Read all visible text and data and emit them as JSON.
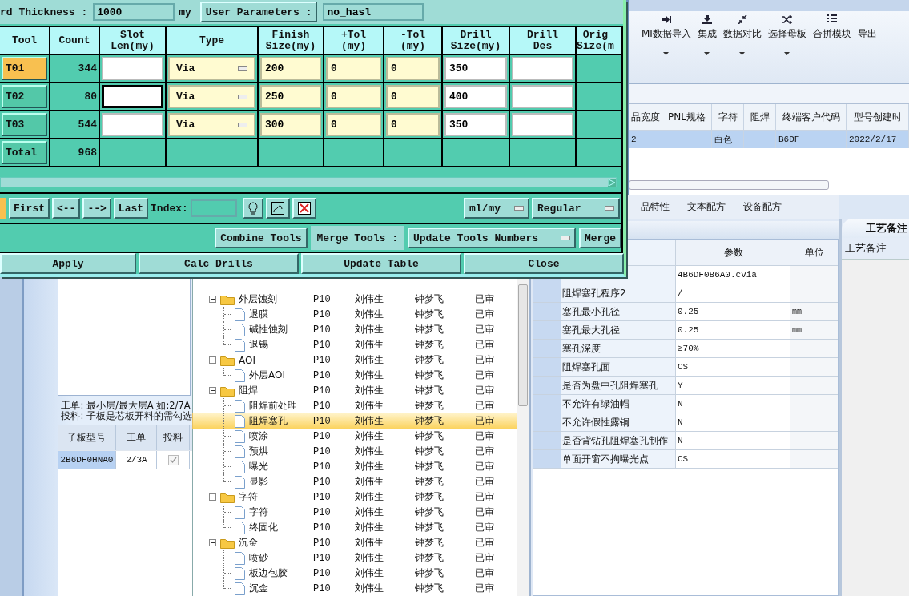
{
  "dialog": {
    "thickness_label": "rd Thickness :",
    "thickness_value": "1000",
    "thickness_unit": "my",
    "user_params_button": "User Parameters :",
    "user_params_value": "no_hasl",
    "columns": [
      "Tool",
      "Count",
      "Slot\nLen(my)",
      "Type",
      "Finish\nSize(my)",
      "+Tol\n(my)",
      "-Tol\n(my)",
      "Drill\nSize(my)",
      "Drill\nDes",
      "Orig\nSize(m"
    ],
    "tools": [
      {
        "tool": "T01",
        "count": "344",
        "selected": true,
        "slot_focused": false,
        "type": "Via",
        "finish": "200",
        "plus_tol": "0",
        "minus_tol": "0",
        "drill_size": "350"
      },
      {
        "tool": "T02",
        "count": "80",
        "selected": false,
        "slot_focused": true,
        "type": "Via",
        "finish": "250",
        "plus_tol": "0",
        "minus_tol": "0",
        "drill_size": "400"
      },
      {
        "tool": "T03",
        "count": "544",
        "selected": false,
        "slot_focused": false,
        "type": "Via",
        "finish": "300",
        "plus_tol": "0",
        "minus_tol": "0",
        "drill_size": "350"
      }
    ],
    "total": {
      "label": "Total",
      "count": "968"
    },
    "nav": [
      "First",
      "<--",
      "-->",
      "Last"
    ],
    "index_label": "Index:",
    "unit_select": "ml/my",
    "mode_select": "Regular",
    "combine_button": "Combine Tools",
    "merge_label": "Merge Tools :",
    "merge_select": "Update Tools Numbers",
    "merge_button": "Merge",
    "actions": [
      "Apply",
      "Calc Drills",
      "Update Table",
      "Close"
    ]
  },
  "toolbar": {
    "items": [
      {
        "label": "MI数据导入",
        "dropdown": true
      },
      {
        "label": "集成",
        "dropdown": true
      },
      {
        "label": "数据对比",
        "dropdown": true
      },
      {
        "label": "选择母板",
        "dropdown": true
      },
      {
        "label": "合拼模块",
        "dropdown": false
      },
      {
        "label": "导出",
        "dropdown": false
      }
    ]
  },
  "grid": {
    "columns": [
      "品宽度",
      "PNL规格",
      "字符",
      "阻焊",
      "终端客户代码",
      "型号创建时"
    ],
    "rows": [
      {
        "selected": true,
        "cells": [
          "2",
          "",
          "白色",
          "",
          "B6DF",
          "2022/2/17"
        ]
      }
    ]
  },
  "tabs": [
    {
      "label": "品特性",
      "selected": false
    },
    {
      "label": "文本配方",
      "selected": false
    },
    {
      "label": "设备配方",
      "selected": false
    }
  ],
  "left_panel": {
    "notes": [
      "工单: 最小层/最大层A 如:2/7A",
      "投料: 子板是芯板开料的需勾选"
    ],
    "columns": [
      "子板型号",
      "工单",
      "投料"
    ],
    "rows": [
      {
        "board": "2B6DF0HNA0",
        "order": "2/3A",
        "feed": true
      }
    ]
  },
  "tree": [
    {
      "name": "外层蚀刻",
      "expanded": true,
      "cols": [
        "P10",
        "刘伟生",
        "钟梦飞",
        "已审"
      ],
      "children": [
        {
          "name": "退膜",
          "selected": false,
          "cols": [
            "P10",
            "刘伟生",
            "钟梦飞",
            "已审"
          ]
        },
        {
          "name": "碱性蚀刻",
          "selected": false,
          "cols": [
            "P10",
            "刘伟生",
            "钟梦飞",
            "已审"
          ]
        },
        {
          "name": "退锡",
          "selected": false,
          "cols": [
            "P10",
            "刘伟生",
            "钟梦飞",
            "已审"
          ]
        }
      ]
    },
    {
      "name": "AOI",
      "expanded": true,
      "cols": [
        "P10",
        "刘伟生",
        "钟梦飞",
        "已审"
      ],
      "children": [
        {
          "name": "外层AOI",
          "selected": false,
          "cols": [
            "P10",
            "刘伟生",
            "钟梦飞",
            "已审"
          ]
        }
      ]
    },
    {
      "name": "阻焊",
      "expanded": true,
      "cols": [
        "P10",
        "刘伟生",
        "钟梦飞",
        "已审"
      ],
      "children": [
        {
          "name": "阻焊前处理",
          "selected": false,
          "cols": [
            "P10",
            "刘伟生",
            "钟梦飞",
            "已审"
          ]
        },
        {
          "name": "阻焊塞孔",
          "selected": true,
          "cols": [
            "P10",
            "刘伟生",
            "钟梦飞",
            "已审"
          ]
        },
        {
          "name": "喷涂",
          "selected": false,
          "cols": [
            "P10",
            "刘伟生",
            "钟梦飞",
            "已审"
          ]
        },
        {
          "name": "预烘",
          "selected": false,
          "cols": [
            "P10",
            "刘伟生",
            "钟梦飞",
            "已审"
          ]
        },
        {
          "name": "曝光",
          "selected": false,
          "cols": [
            "P10",
            "刘伟生",
            "钟梦飞",
            "已审"
          ]
        },
        {
          "name": "显影",
          "selected": false,
          "cols": [
            "P10",
            "刘伟生",
            "钟梦飞",
            "已审"
          ]
        }
      ]
    },
    {
      "name": "字符",
      "expanded": true,
      "cols": [
        "P10",
        "刘伟生",
        "钟梦飞",
        "已审"
      ],
      "children": [
        {
          "name": "字符",
          "selected": false,
          "cols": [
            "P10",
            "刘伟生",
            "钟梦飞",
            "已审"
          ]
        },
        {
          "name": "终固化",
          "selected": false,
          "cols": [
            "P10",
            "刘伟生",
            "钟梦飞",
            "已审"
          ]
        }
      ]
    },
    {
      "name": "沉金",
      "expanded": true,
      "cols": [
        "P10",
        "刘伟生",
        "钟梦飞",
        "已审"
      ],
      "children": [
        {
          "name": "喷砂",
          "selected": false,
          "cols": [
            "P10",
            "刘伟生",
            "钟梦飞",
            "已审"
          ]
        },
        {
          "name": "板边包胶",
          "selected": false,
          "cols": [
            "P10",
            "刘伟生",
            "钟梦飞",
            "已审"
          ]
        },
        {
          "name": "沉金",
          "selected": false,
          "cols": [
            "P10",
            "刘伟生",
            "钟梦飞",
            "已审"
          ]
        }
      ]
    }
  ],
  "params": {
    "columns": [
      "参数",
      "单位"
    ],
    "rows": [
      {
        "value": "4B6DF086A0.cvia"
      },
      {
        "name": "阻焊塞孔程序2",
        "value": "/"
      },
      {
        "name": "塞孔最小孔径",
        "value": "0.25",
        "unit": "mm"
      },
      {
        "name": "塞孔最大孔径",
        "value": "0.25",
        "unit": "mm"
      },
      {
        "name": "塞孔深度",
        "value": "≥70%"
      },
      {
        "name": "阻焊塞孔面",
        "value": "CS"
      },
      {
        "name": "是否为盘中孔阻焊塞孔",
        "value": "Y"
      },
      {
        "name": "不允许有绿油帽",
        "value": "N"
      },
      {
        "name": "不允许假性露铜",
        "value": "N"
      },
      {
        "name": "是否背钻孔阻焊塞孔制作",
        "value": "N"
      },
      {
        "name": "单面开窗不掏曝光点",
        "value": "CS"
      }
    ]
  },
  "notes_panel": {
    "tab": "工艺备注",
    "item": "工艺备注"
  }
}
